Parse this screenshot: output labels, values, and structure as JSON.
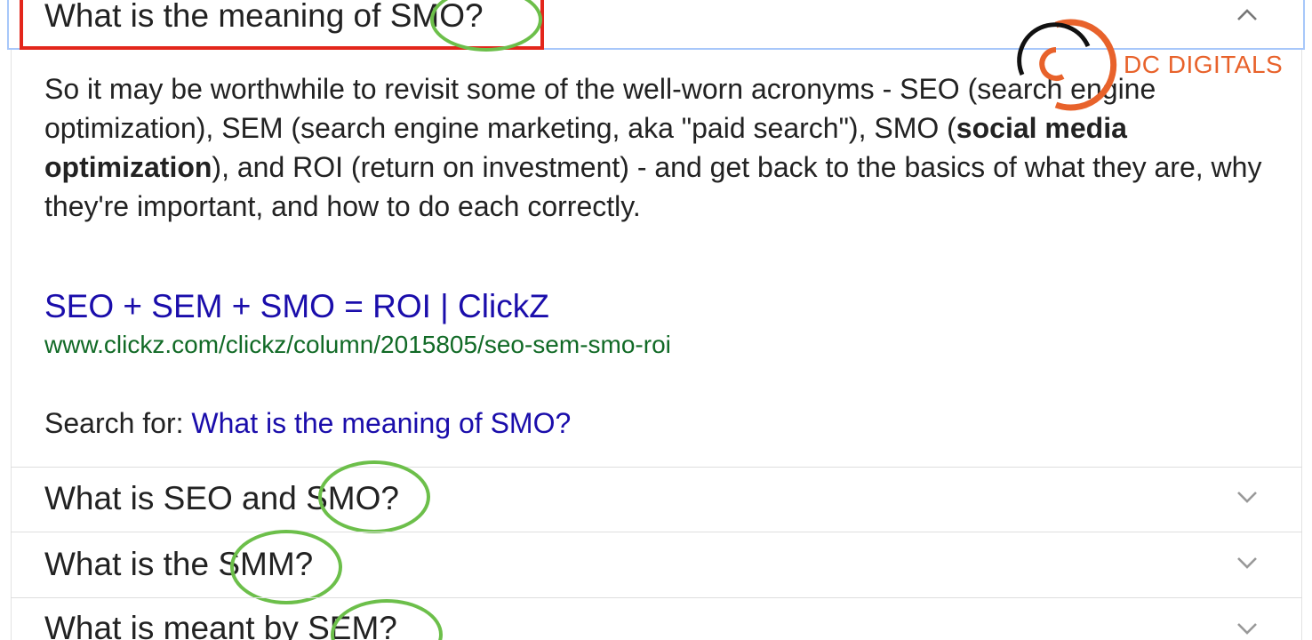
{
  "expanded_question": {
    "title": "What is the meaning of SMO?",
    "answer_parts": {
      "p1": "So it may be worthwhile to revisit some of the well-worn acronyms - SEO (search engine optimization), SEM (search engine marketing, aka \"paid search\"), SMO (",
      "bold": "social media optimization",
      "p2": "), and ROI (return on investment) - and get back to the basics of what they are, why they're important, and how to do each correctly."
    },
    "source_title": "SEO + SEM + SMO = ROI | ClickZ",
    "source_url": "www.clickz.com/clickz/column/2015805/seo-sem-smo-roi",
    "search_for_label": "Search for:",
    "search_for_query": "What is the meaning of SMO?"
  },
  "related_questions": [
    {
      "title": "What is SEO and SMO?"
    },
    {
      "title": "What is the SMM?"
    },
    {
      "title": "What is meant by SEM?"
    }
  ],
  "watermark": {
    "text": "DC DIGITALS",
    "color": "#e8622b"
  },
  "colors": {
    "link": "#1a0dab",
    "url": "#116a26",
    "highlight_ring": "#6cbf4a",
    "highlight_box": "#e3261b"
  },
  "icons": {
    "expanded": "chevron-up-icon",
    "collapsed": "chevron-down-icon"
  }
}
